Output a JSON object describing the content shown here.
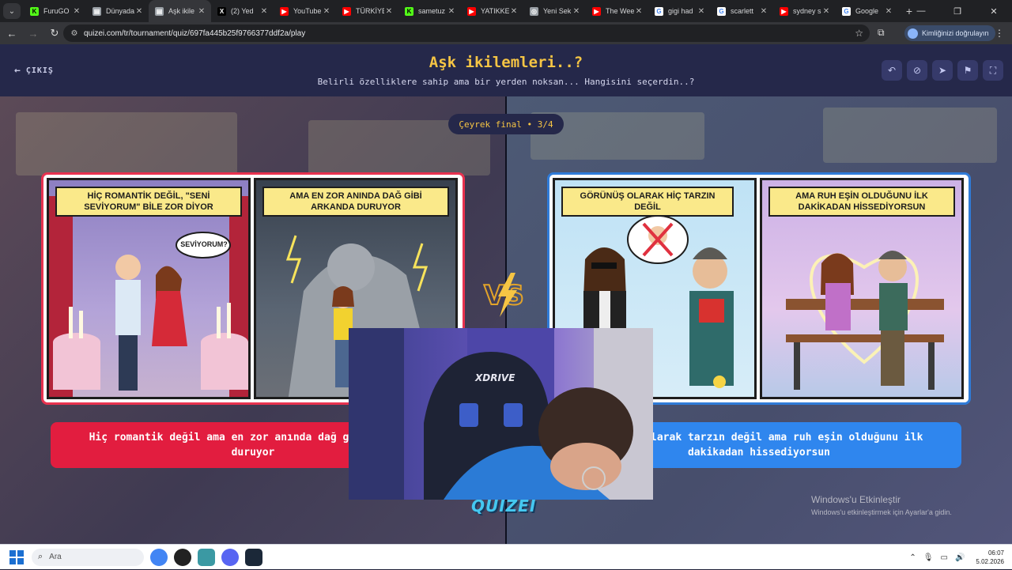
{
  "browser": {
    "tabs": [
      {
        "label": "FuruGO",
        "favicon": "k-icon",
        "color": "#53fc18",
        "active": false
      },
      {
        "label": "Dünyada",
        "favicon": "page-icon",
        "color": "#9aa0a6",
        "active": false
      },
      {
        "label": "Aşk ikile",
        "favicon": "page-icon",
        "color": "#9aa0a6",
        "active": true
      },
      {
        "label": "(2) Yed",
        "favicon": "x-icon",
        "color": "#000000",
        "active": false
      },
      {
        "label": "YouTube",
        "favicon": "youtube-icon",
        "color": "#ff0000",
        "active": false
      },
      {
        "label": "TÜRKİYE",
        "favicon": "youtube-icon",
        "color": "#ff0000",
        "active": false
      },
      {
        "label": "sametuz",
        "favicon": "k-icon",
        "color": "#53fc18",
        "active": false
      },
      {
        "label": "YATIKKE",
        "favicon": "youtube-icon",
        "color": "#ff0000",
        "active": false
      },
      {
        "label": "Yeni Sek",
        "favicon": "globe-icon",
        "color": "#9aa0a6",
        "active": false
      },
      {
        "label": "The Wee",
        "favicon": "youtube-icon",
        "color": "#ff0000",
        "active": false
      },
      {
        "label": "gigi had",
        "favicon": "google-icon",
        "color": "#ffffff",
        "active": false
      },
      {
        "label": "scarlett",
        "favicon": "google-icon",
        "color": "#ffffff",
        "active": false
      },
      {
        "label": "sydney s",
        "favicon": "youtube-icon",
        "color": "#ff0000",
        "active": false
      },
      {
        "label": "Google",
        "favicon": "google-icon",
        "color": "#ffffff",
        "active": false
      }
    ],
    "url": "quizei.com/tr/tournament/quiz/697fa445b25f9766377ddf2a/play",
    "profile_label": "Kimliğinizi doğrulayın"
  },
  "header": {
    "exit_label": "ÇIKIŞ",
    "title": "Aşk ikilemleri..?",
    "subtitle": "Belirli özelliklere sahip ama bir yerden noksan... Hangisini seçerdin..?"
  },
  "round": {
    "label": "Çeyrek final • 3/4"
  },
  "left_card": {
    "panel1_caption": "HİÇ ROMANTİK DEĞİL, \"SENİ SEVİYORUM\" BİLE ZOR DİYOR",
    "bubble": "SEVİYORUM?",
    "panel2_caption": "AMA EN ZOR ANINDA DAĞ GİBİ ARKANDA DURUYOR",
    "answer": "Hiç romantik değil ama en zor anında dağ gibi arkanda duruyor",
    "accent": "#e21d3f"
  },
  "right_card": {
    "panel1_caption": "GÖRÜNÜŞ OLARAK HİÇ TARZIN DEĞİL",
    "panel2_caption": "AMA RUH EŞİN OLDUĞUNU İLK DAKİKADAN HİSSEDİYORSUN",
    "answer": "Görünüş olarak tarzın değil ama ruh eşin olduğunu ilk dakikadan hissediyorsun",
    "accent": "#2f86ee"
  },
  "vs_label": "VS",
  "brand": "QUIZEI",
  "webcam": {
    "chair_brand": "XDRIVE"
  },
  "windows_activation": {
    "title": "Windows'u Etkinleştir",
    "body": "Windows'u etkinleştirmek için Ayarlar'a gidin."
  },
  "taskbar": {
    "search_placeholder": "Ara",
    "time": "06:07",
    "date": "5.02.2026"
  }
}
